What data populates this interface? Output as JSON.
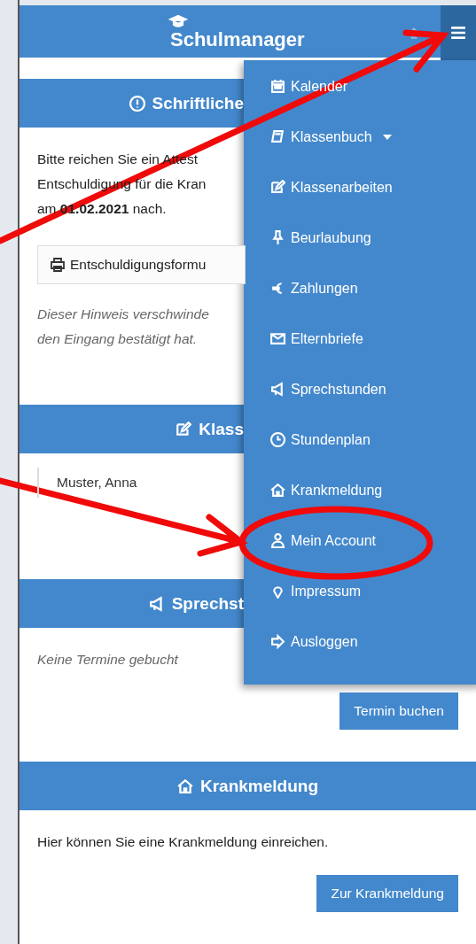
{
  "header": {
    "title": "Schulmanager"
  },
  "menu": {
    "open": true,
    "items": [
      {
        "label": "Kalender",
        "submenu": false
      },
      {
        "label": "Klassenbuch",
        "submenu": true
      },
      {
        "label": "Klassenarbeiten",
        "submenu": false
      },
      {
        "label": "Beurlaubung",
        "submenu": false
      },
      {
        "label": "Zahlungen",
        "submenu": false
      },
      {
        "label": "Elternbriefe",
        "submenu": false
      },
      {
        "label": "Sprechstunden",
        "submenu": false
      },
      {
        "label": "Stundenplan",
        "submenu": false
      },
      {
        "label": "Krankmeldung",
        "submenu": false
      },
      {
        "label": "Mein Account",
        "submenu": false
      },
      {
        "label": "Impressum",
        "submenu": false
      },
      {
        "label": "Ausloggen",
        "submenu": false
      }
    ]
  },
  "cards": [
    {
      "title": "Schriftliche",
      "blocks": [
        {
          "kind": "text",
          "text": "Bitte reichen Sie ein Attest"
        },
        {
          "kind": "text",
          "text": "Entschuldigung für die Kran"
        },
        {
          "kind": "text",
          "text": "am **01.02.2021** nach."
        },
        {
          "kind": "outline-button",
          "label": "Entschuldigungsformu"
        },
        {
          "kind": "note",
          "text": "Dieser Hinweis verschwinde"
        },
        {
          "kind": "note",
          "text": "den Eingang bestätigt hat."
        }
      ]
    },
    {
      "title": "Klass",
      "blocks": [
        {
          "kind": "name",
          "text": "Muster, Anna"
        }
      ]
    },
    {
      "title": "Sprechst",
      "blocks": [
        {
          "kind": "note",
          "text": "Keine Termine gebucht"
        },
        {
          "kind": "button",
          "label": "Termin buchen"
        }
      ]
    },
    {
      "title": "Krankmeldung",
      "blocks": [
        {
          "kind": "text",
          "text": "Hier können Sie eine Krankmeldung einreichen."
        },
        {
          "kind": "button",
          "label": "Zur Krankmeldung"
        }
      ]
    }
  ]
}
